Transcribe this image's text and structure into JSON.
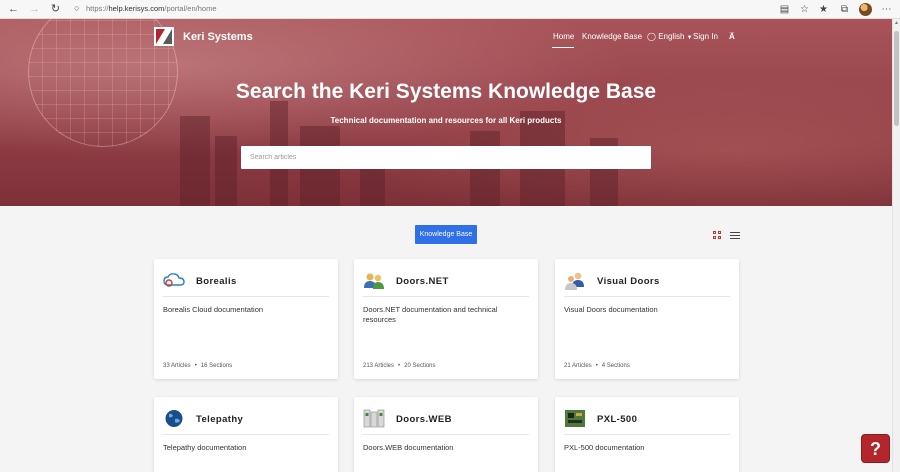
{
  "browser": {
    "url_prefix": "https://",
    "url_host": "help.kerisys.com",
    "url_path": "/portal/en/home"
  },
  "header": {
    "brand": "Keri Systems",
    "nav": {
      "home": "Home",
      "knowledge_base": "Knowledge Base",
      "language": "English",
      "sign_in": "Sign In"
    }
  },
  "hero": {
    "title": "Search the Keri Systems Knowledge Base",
    "subtitle": "Technical documentation and resources for all Keri products",
    "search_placeholder": "Search articles"
  },
  "toolbar": {
    "knowledge_base_button": "Knowledge Base"
  },
  "categories": [
    {
      "title": "Borealis",
      "description": "Borealis Cloud documentation",
      "articles": "33 Articles",
      "sections": "16 Sections",
      "icon": "cloud-icon"
    },
    {
      "title": "Doors.NET",
      "description": "Doors.NET documentation and technical resources",
      "articles": "213 Articles",
      "sections": "20 Sections",
      "icon": "users-icon"
    },
    {
      "title": "Visual Doors",
      "description": "Visual Doors documentation",
      "articles": "21 Articles",
      "sections": "4 Sections",
      "icon": "user-group-icon"
    },
    {
      "title": "Telepathy",
      "description": "Telepathy documentation",
      "icon": "globe-icon"
    },
    {
      "title": "Doors.WEB",
      "description": "Doors.WEB documentation",
      "icon": "server-icon"
    },
    {
      "title": "PXL-500",
      "description": "PXL-500 documentation",
      "icon": "circuit-board-icon"
    }
  ],
  "help": {
    "label": "?"
  },
  "colors": {
    "accent": "#2f6fe8",
    "brand": "#b3262b",
    "hero": "#934048"
  }
}
